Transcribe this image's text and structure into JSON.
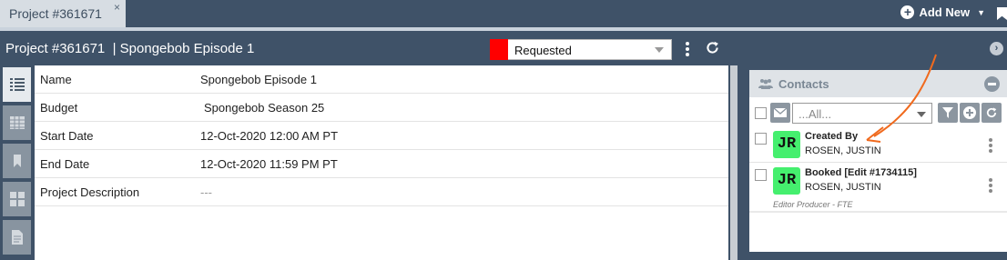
{
  "topbar": {
    "tab_label": "Project #361671",
    "tab_close": "×",
    "add_new_label": "Add New"
  },
  "project": {
    "id_label": "Project #361671",
    "separator": "|",
    "name": "Spongebob Episode 1",
    "status": {
      "label": "Requested",
      "color": "#ff0000"
    }
  },
  "details": {
    "rows": [
      {
        "label": "Name",
        "value": "Spongebob Episode 1"
      },
      {
        "label": "Budget",
        "value": "Spongebob Season 25"
      },
      {
        "label": "Start Date",
        "value": "12-Oct-2020 12:00 AM PT"
      },
      {
        "label": "End Date",
        "value": "12-Oct-2020 11:59 PM PT"
      },
      {
        "label": "Project Description",
        "value": "---"
      }
    ]
  },
  "sidenav": {
    "items": [
      "list-icon",
      "table-icon",
      "bookmark-icon",
      "grid-icon",
      "document-icon"
    ]
  },
  "contacts": {
    "title": "Contacts",
    "filter_placeholder": "...All...",
    "items": [
      {
        "initials": "JR",
        "role": "Created By",
        "name": "ROSEN, JUSTIN",
        "avatar_color": "#45ef6e"
      },
      {
        "initials": "JR",
        "role": "Booked [Edit #1734115]",
        "name": "ROSEN, JUSTIN",
        "subtitle": "Editor Producer - FTE",
        "avatar_color": "#45ef6e"
      }
    ]
  },
  "colors": {
    "chrome": "#3f5268",
    "accent_arrow": "#f06a1e"
  }
}
